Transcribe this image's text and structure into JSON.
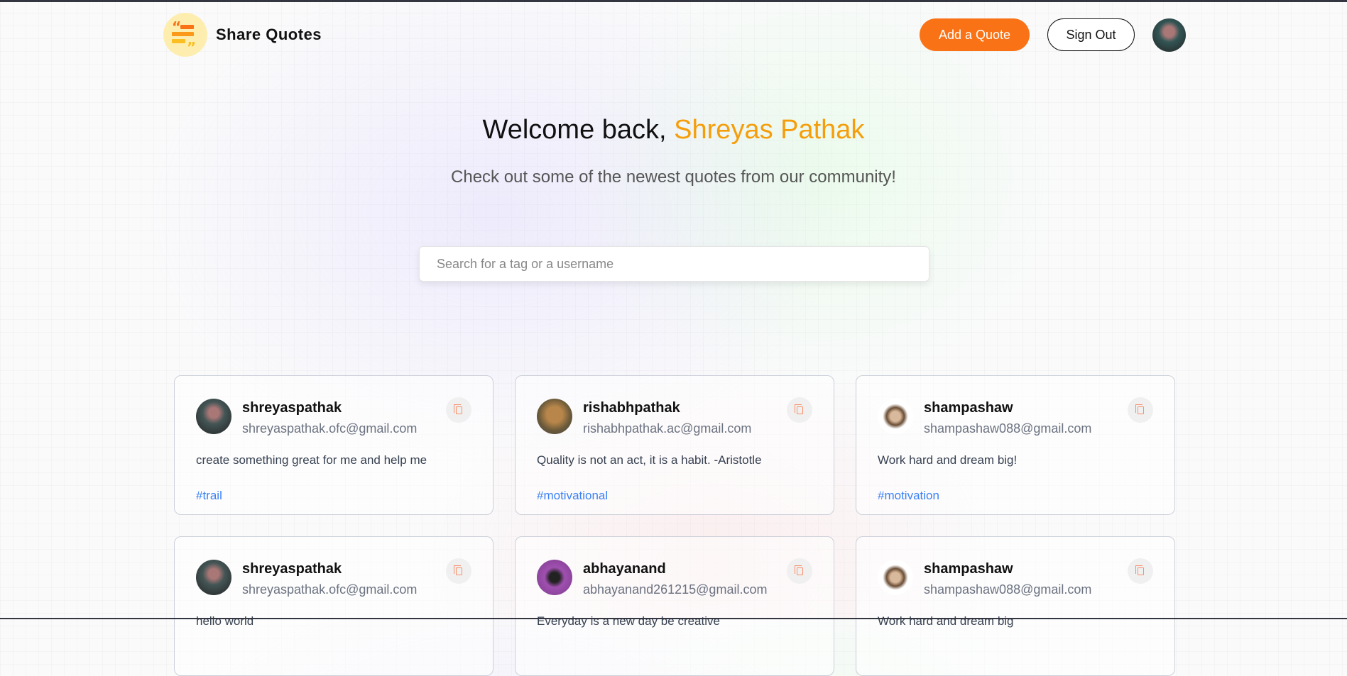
{
  "header": {
    "brand": "Share Quotes",
    "add_label": "Add a Quote",
    "signout_label": "Sign Out",
    "accent": "#f97316"
  },
  "hero": {
    "greeting": "Welcome back, ",
    "user_name": "Shreyas Pathak",
    "subtitle": "Check out some of the newest quotes from our community!"
  },
  "search": {
    "placeholder": "Search for a tag or a username",
    "value": ""
  },
  "quotes": [
    {
      "username": "shreyaspathak",
      "email": "shreyaspathak.ofc@gmail.com",
      "text": "create something great for me and help me",
      "tag": "#trail"
    },
    {
      "username": "rishabhpathak",
      "email": "rishabhpathak.ac@gmail.com",
      "text": "Quality is not an act, it is a habit. -Aristotle",
      "tag": "#motivational"
    },
    {
      "username": "shampashaw",
      "email": "shampashaw088@gmail.com",
      "text": "Work hard and dream big!",
      "tag": "#motivation"
    },
    {
      "username": "shreyaspathak",
      "email": "shreyaspathak.ofc@gmail.com",
      "text": "hello world",
      "tag": ""
    },
    {
      "username": "abhayanand",
      "email": "abhayanand261215@gmail.com",
      "text": "Everyday is a new day be creative",
      "tag": ""
    },
    {
      "username": "shampashaw",
      "email": "shampashaw088@gmail.com",
      "text": "Work hard and dream big",
      "tag": ""
    }
  ]
}
